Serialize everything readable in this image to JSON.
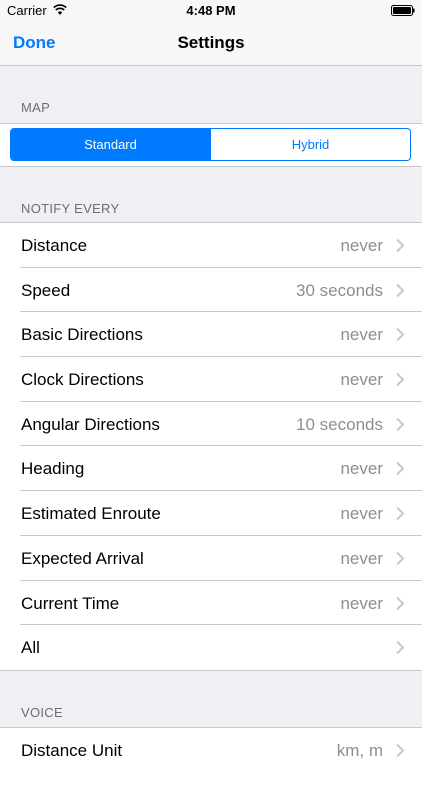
{
  "status_bar": {
    "carrier": "Carrier",
    "time": "4:48 PM"
  },
  "nav": {
    "done_label": "Done",
    "title": "Settings"
  },
  "map_section": {
    "header": "MAP",
    "options": [
      "Standard",
      "Hybrid"
    ],
    "selected": "Standard"
  },
  "notify_section": {
    "header": "NOTIFY EVERY",
    "rows": [
      {
        "label": "Distance",
        "value": "never"
      },
      {
        "label": "Speed",
        "value": "30 seconds"
      },
      {
        "label": "Basic Directions",
        "value": "never"
      },
      {
        "label": "Clock Directions",
        "value": "never"
      },
      {
        "label": "Angular Directions",
        "value": "10 seconds"
      },
      {
        "label": "Heading",
        "value": "never"
      },
      {
        "label": "Estimated Enroute",
        "value": "never"
      },
      {
        "label": "Expected Arrival",
        "value": "never"
      },
      {
        "label": "Current Time",
        "value": "never"
      },
      {
        "label": "All",
        "value": ""
      }
    ]
  },
  "voice_section": {
    "header": "VOICE",
    "rows": [
      {
        "label": "Distance Unit",
        "value": "km, m"
      }
    ]
  },
  "colors": {
    "accent": "#007aff",
    "background": "#efeff4",
    "secondary_text": "#8e8e93"
  }
}
